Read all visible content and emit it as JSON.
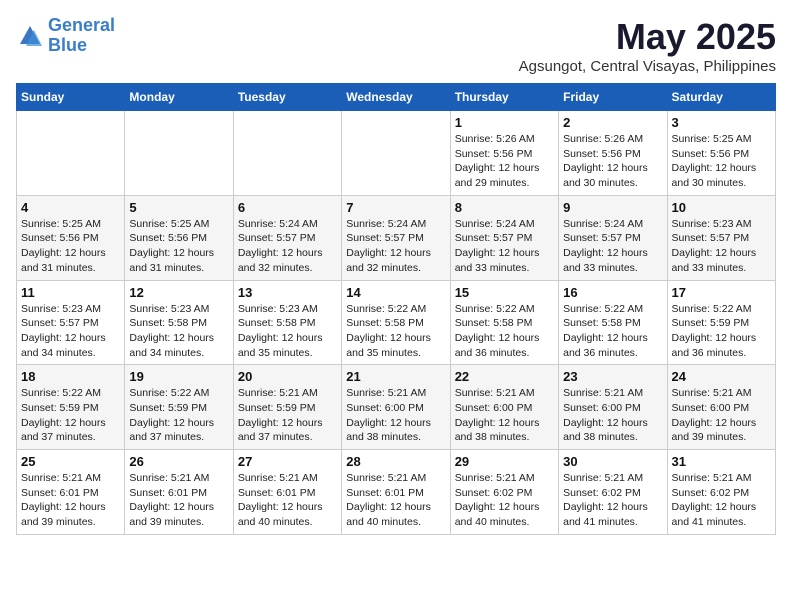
{
  "header": {
    "logo_line1": "General",
    "logo_line2": "Blue",
    "month_title": "May 2025",
    "subtitle": "Agsungot, Central Visayas, Philippines"
  },
  "weekdays": [
    "Sunday",
    "Monday",
    "Tuesday",
    "Wednesday",
    "Thursday",
    "Friday",
    "Saturday"
  ],
  "weeks": [
    [
      {
        "day": "",
        "info": ""
      },
      {
        "day": "",
        "info": ""
      },
      {
        "day": "",
        "info": ""
      },
      {
        "day": "",
        "info": ""
      },
      {
        "day": "1",
        "info": "Sunrise: 5:26 AM\nSunset: 5:56 PM\nDaylight: 12 hours\nand 29 minutes."
      },
      {
        "day": "2",
        "info": "Sunrise: 5:26 AM\nSunset: 5:56 PM\nDaylight: 12 hours\nand 30 minutes."
      },
      {
        "day": "3",
        "info": "Sunrise: 5:25 AM\nSunset: 5:56 PM\nDaylight: 12 hours\nand 30 minutes."
      }
    ],
    [
      {
        "day": "4",
        "info": "Sunrise: 5:25 AM\nSunset: 5:56 PM\nDaylight: 12 hours\nand 31 minutes."
      },
      {
        "day": "5",
        "info": "Sunrise: 5:25 AM\nSunset: 5:56 PM\nDaylight: 12 hours\nand 31 minutes."
      },
      {
        "day": "6",
        "info": "Sunrise: 5:24 AM\nSunset: 5:57 PM\nDaylight: 12 hours\nand 32 minutes."
      },
      {
        "day": "7",
        "info": "Sunrise: 5:24 AM\nSunset: 5:57 PM\nDaylight: 12 hours\nand 32 minutes."
      },
      {
        "day": "8",
        "info": "Sunrise: 5:24 AM\nSunset: 5:57 PM\nDaylight: 12 hours\nand 33 minutes."
      },
      {
        "day": "9",
        "info": "Sunrise: 5:24 AM\nSunset: 5:57 PM\nDaylight: 12 hours\nand 33 minutes."
      },
      {
        "day": "10",
        "info": "Sunrise: 5:23 AM\nSunset: 5:57 PM\nDaylight: 12 hours\nand 33 minutes."
      }
    ],
    [
      {
        "day": "11",
        "info": "Sunrise: 5:23 AM\nSunset: 5:57 PM\nDaylight: 12 hours\nand 34 minutes."
      },
      {
        "day": "12",
        "info": "Sunrise: 5:23 AM\nSunset: 5:58 PM\nDaylight: 12 hours\nand 34 minutes."
      },
      {
        "day": "13",
        "info": "Sunrise: 5:23 AM\nSunset: 5:58 PM\nDaylight: 12 hours\nand 35 minutes."
      },
      {
        "day": "14",
        "info": "Sunrise: 5:22 AM\nSunset: 5:58 PM\nDaylight: 12 hours\nand 35 minutes."
      },
      {
        "day": "15",
        "info": "Sunrise: 5:22 AM\nSunset: 5:58 PM\nDaylight: 12 hours\nand 36 minutes."
      },
      {
        "day": "16",
        "info": "Sunrise: 5:22 AM\nSunset: 5:58 PM\nDaylight: 12 hours\nand 36 minutes."
      },
      {
        "day": "17",
        "info": "Sunrise: 5:22 AM\nSunset: 5:59 PM\nDaylight: 12 hours\nand 36 minutes."
      }
    ],
    [
      {
        "day": "18",
        "info": "Sunrise: 5:22 AM\nSunset: 5:59 PM\nDaylight: 12 hours\nand 37 minutes."
      },
      {
        "day": "19",
        "info": "Sunrise: 5:22 AM\nSunset: 5:59 PM\nDaylight: 12 hours\nand 37 minutes."
      },
      {
        "day": "20",
        "info": "Sunrise: 5:21 AM\nSunset: 5:59 PM\nDaylight: 12 hours\nand 37 minutes."
      },
      {
        "day": "21",
        "info": "Sunrise: 5:21 AM\nSunset: 6:00 PM\nDaylight: 12 hours\nand 38 minutes."
      },
      {
        "day": "22",
        "info": "Sunrise: 5:21 AM\nSunset: 6:00 PM\nDaylight: 12 hours\nand 38 minutes."
      },
      {
        "day": "23",
        "info": "Sunrise: 5:21 AM\nSunset: 6:00 PM\nDaylight: 12 hours\nand 38 minutes."
      },
      {
        "day": "24",
        "info": "Sunrise: 5:21 AM\nSunset: 6:00 PM\nDaylight: 12 hours\nand 39 minutes."
      }
    ],
    [
      {
        "day": "25",
        "info": "Sunrise: 5:21 AM\nSunset: 6:01 PM\nDaylight: 12 hours\nand 39 minutes."
      },
      {
        "day": "26",
        "info": "Sunrise: 5:21 AM\nSunset: 6:01 PM\nDaylight: 12 hours\nand 39 minutes."
      },
      {
        "day": "27",
        "info": "Sunrise: 5:21 AM\nSunset: 6:01 PM\nDaylight: 12 hours\nand 40 minutes."
      },
      {
        "day": "28",
        "info": "Sunrise: 5:21 AM\nSunset: 6:01 PM\nDaylight: 12 hours\nand 40 minutes."
      },
      {
        "day": "29",
        "info": "Sunrise: 5:21 AM\nSunset: 6:02 PM\nDaylight: 12 hours\nand 40 minutes."
      },
      {
        "day": "30",
        "info": "Sunrise: 5:21 AM\nSunset: 6:02 PM\nDaylight: 12 hours\nand 41 minutes."
      },
      {
        "day": "31",
        "info": "Sunrise: 5:21 AM\nSunset: 6:02 PM\nDaylight: 12 hours\nand 41 minutes."
      }
    ]
  ]
}
